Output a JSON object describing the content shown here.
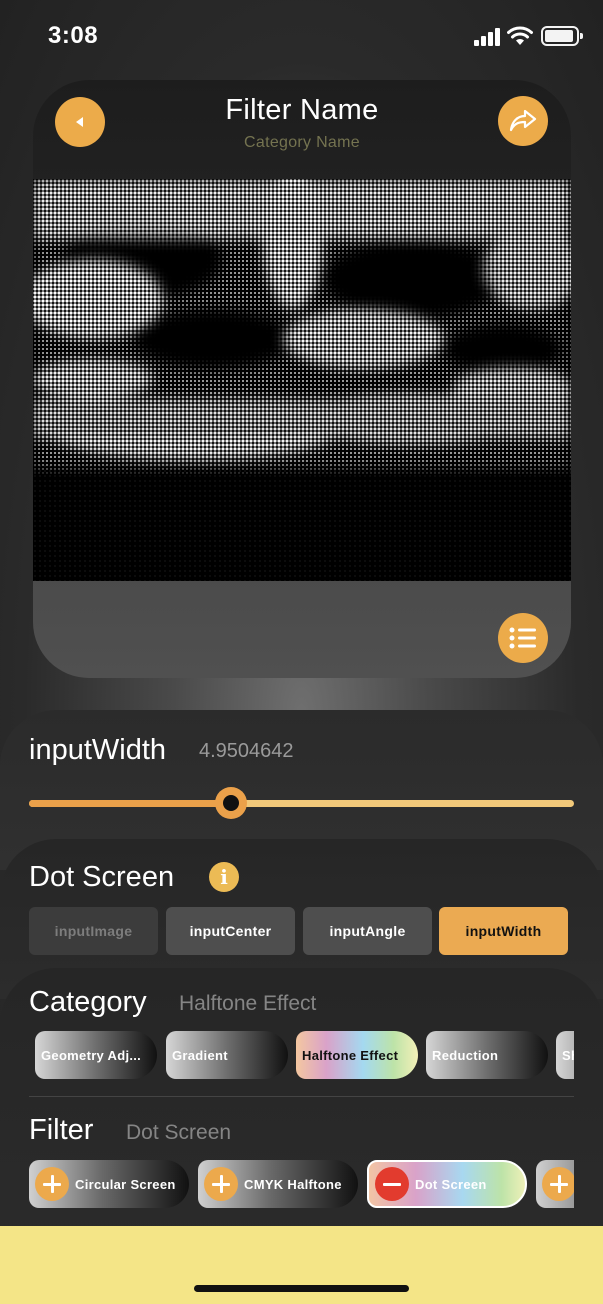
{
  "status_bar": {
    "time": "3:08",
    "battery": "full",
    "wifi": "wifi-icon",
    "signal": "cellular-signal-icon"
  },
  "preview_card": {
    "title": "Filter Name",
    "subtitle": "Category Name",
    "back_icon": "back-arrow-icon",
    "share_icon": "share-icon",
    "list_icon": "list-icon",
    "image": "halftone dot screen sky image"
  },
  "slider": {
    "param_name": "inputWidth",
    "value": "4.9504642",
    "fill_fraction": 0.37
  },
  "filter_params": {
    "title": "Dot Screen",
    "info_icon": "i",
    "tabs": [
      {
        "label": "inputImage",
        "state": "disabled"
      },
      {
        "label": "inputCenter",
        "state": "normal"
      },
      {
        "label": "inputAngle",
        "state": "normal"
      },
      {
        "label": "inputWidth",
        "state": "active"
      }
    ]
  },
  "category": {
    "title": "Category",
    "current": "Halftone Effect",
    "chips": [
      "Geometry Adj...",
      "Gradient",
      "Halftone Effect",
      "Reduction",
      "Sh"
    ]
  },
  "filter": {
    "title": "Filter",
    "current": "Dot Screen",
    "chips": [
      {
        "label": "Circular Screen",
        "icon": "plus-icon"
      },
      {
        "label": "CMYK Halftone",
        "icon": "plus-icon"
      },
      {
        "label": "Dot Screen",
        "icon": "minus-icon"
      },
      {
        "label": "",
        "icon": "plus-icon"
      }
    ]
  },
  "colors": {
    "accent": "#ecab4a",
    "remove": "#e23b2e",
    "bottom_bar": "#f4e587"
  }
}
